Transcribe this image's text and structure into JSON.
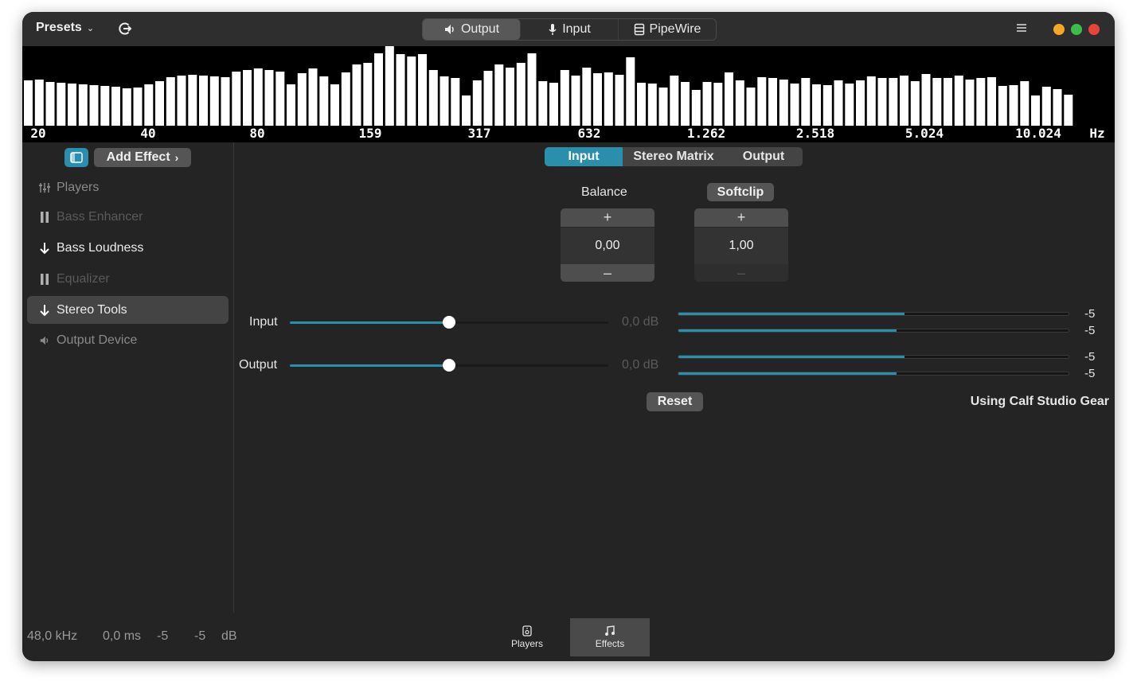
{
  "header": {
    "presets_label": "Presets",
    "modes": [
      {
        "label": "Output",
        "icon": "speaker-icon",
        "active": true
      },
      {
        "label": "Input",
        "icon": "microphone-icon",
        "active": false
      },
      {
        "label": "PipeWire",
        "icon": "server-icon",
        "active": false
      }
    ],
    "window_buttons": {
      "minimize": "#f5a623",
      "maximize": "#3cbf4a",
      "close": "#e8433a"
    }
  },
  "spectrum": {
    "bar_levels": [
      0.57,
      0.58,
      0.55,
      0.54,
      0.53,
      0.52,
      0.51,
      0.5,
      0.49,
      0.47,
      0.48,
      0.52,
      0.56,
      0.61,
      0.63,
      0.64,
      0.63,
      0.62,
      0.61,
      0.68,
      0.7,
      0.72,
      0.7,
      0.68,
      0.52,
      0.66,
      0.72,
      0.62,
      0.52,
      0.67,
      0.77,
      0.79,
      0.91,
      1.0,
      0.9,
      0.87,
      0.9,
      0.7,
      0.62,
      0.6,
      0.38,
      0.57,
      0.69,
      0.77,
      0.73,
      0.79,
      0.91,
      0.56,
      0.54,
      0.7,
      0.63,
      0.73,
      0.66,
      0.67,
      0.64,
      0.86,
      0.54,
      0.53,
      0.48,
      0.63,
      0.55,
      0.45,
      0.55,
      0.54,
      0.67,
      0.57,
      0.48,
      0.61,
      0.6,
      0.58,
      0.53,
      0.6,
      0.52,
      0.51,
      0.57,
      0.53,
      0.57,
      0.62,
      0.6,
      0.6,
      0.63,
      0.56,
      0.65,
      0.6,
      0.6,
      0.63,
      0.58,
      0.6,
      0.61,
      0.5,
      0.51,
      0.56,
      0.38,
      0.49,
      0.46,
      0.39
    ],
    "freq_labels": [
      "20",
      "40",
      "80",
      "159",
      "317",
      "632",
      "1.262",
      "2.518",
      "5.024",
      "10.024",
      "Hz"
    ]
  },
  "sidebar": {
    "add_effect_label": "Add Effect",
    "items": [
      {
        "label": "Players",
        "icon": "equalizer-icon",
        "state": "dim"
      },
      {
        "label": "Bass Enhancer",
        "icon": "pause-icon",
        "state": "disabled"
      },
      {
        "label": "Bass Loudness",
        "icon": "arrow-down-icon",
        "state": "normal"
      },
      {
        "label": "Equalizer",
        "icon": "pause-icon",
        "state": "disabled"
      },
      {
        "label": "Stereo Tools",
        "icon": "arrow-down-icon",
        "state": "selected"
      },
      {
        "label": "Output Device",
        "icon": "speaker-icon",
        "state": "dim"
      }
    ]
  },
  "main": {
    "tabs": [
      {
        "label": "Input",
        "active": true
      },
      {
        "label": "Stereo Matrix",
        "active": false
      },
      {
        "label": "Output",
        "active": false
      }
    ],
    "balance_label": "Balance",
    "balance_value": "0,00",
    "softclip_label": "Softclip",
    "softclip_value": "1,00",
    "plus_symbol": "+",
    "minus_symbol": "–",
    "input_label": "Input",
    "input_gain": "0,0 dB",
    "input_level": 0.5,
    "output_label": "Output",
    "output_gain": "0,0 dB",
    "output_level": 0.5,
    "meters": [
      {
        "value": "-5",
        "fill": 0.58
      },
      {
        "value": "-5",
        "fill": 0.56
      },
      {
        "value": "-5",
        "fill": 0.58
      },
      {
        "value": "-5",
        "fill": 0.56
      }
    ],
    "reset_label": "Reset",
    "using_label": "Using Calf Studio Gear"
  },
  "footer": {
    "sample_rate": "48,0 kHz",
    "latency": "0,0 ms",
    "level_left": "-5",
    "level_right": "-5",
    "level_unit": "dB",
    "tabs": [
      {
        "label": "Players",
        "icon": "player-icon",
        "active": false
      },
      {
        "label": "Effects",
        "icon": "music-note-icon",
        "active": true
      }
    ]
  },
  "colors": {
    "accent": "#2a8fad"
  }
}
